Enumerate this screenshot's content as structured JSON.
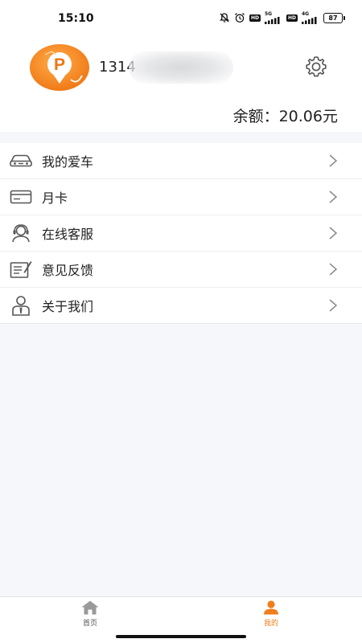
{
  "status_bar": {
    "time": "15:10",
    "hd1": "HD",
    "net1": "5G",
    "hd2": "HD",
    "net2": "4G",
    "battery": "87",
    "icons": [
      "mute-bell-icon",
      "alarm-icon",
      "signal-icon",
      "battery-icon"
    ]
  },
  "profile": {
    "phone_prefix": "1314",
    "balance_text": "余额：20.06元",
    "avatar_icon": "parking-logo-icon",
    "settings_icon": "gear-icon"
  },
  "menu": {
    "items": [
      {
        "label": "我的爱车",
        "icon": "car-icon"
      },
      {
        "label": "月卡",
        "icon": "card-icon"
      },
      {
        "label": "在线客服",
        "icon": "headset-icon"
      },
      {
        "label": "意见反馈",
        "icon": "feedback-icon"
      },
      {
        "label": "关于我们",
        "icon": "person-icon"
      }
    ]
  },
  "tabbar": {
    "tabs": [
      {
        "label": "首页",
        "icon": "home-icon",
        "active": false
      },
      {
        "label": "我的",
        "icon": "user-icon",
        "active": true
      }
    ]
  },
  "colors": {
    "accent": "#f07d1a",
    "background": "#f5f7fa",
    "text": "#222222"
  }
}
